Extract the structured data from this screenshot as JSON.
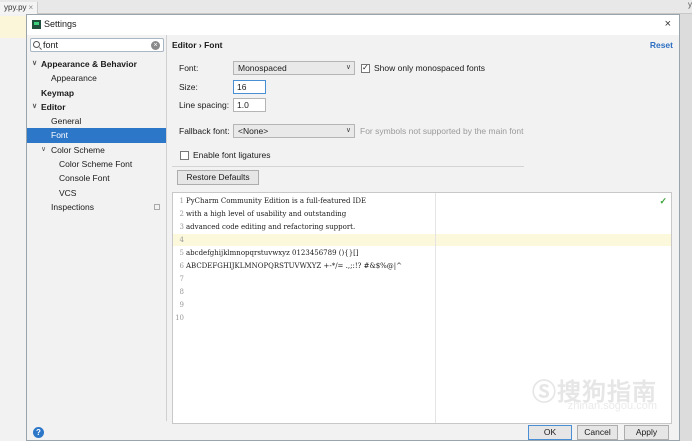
{
  "background": {
    "tab_label": "ypy.py",
    "tab_close": "×",
    "right_text": "y"
  },
  "dialog": {
    "title": "Settings",
    "close": "×"
  },
  "search": {
    "value": "font",
    "clear_glyph": "⊗"
  },
  "tree": [
    {
      "label": "Appearance & Behavior",
      "chev": "∨"
    },
    {
      "label": "Appearance"
    },
    {
      "label": "Keymap"
    },
    {
      "label": "Editor",
      "chev": "∨"
    },
    {
      "label": "General"
    },
    {
      "label": "Font"
    },
    {
      "label": "Color Scheme",
      "chev": "∨"
    },
    {
      "label": "Color Scheme Font"
    },
    {
      "label": "Console Font"
    },
    {
      "label": "VCS"
    },
    {
      "label": "Inspections"
    }
  ],
  "header": {
    "breadcrumb": "Editor › Font",
    "reset": "Reset"
  },
  "font": {
    "font_label": "Font:",
    "font_value": "Monospaced",
    "mono_only_label": "Show only monospaced fonts",
    "mono_only_checked": true,
    "size_label": "Size:",
    "size_value": "16",
    "spacing_label": "Line spacing:",
    "spacing_value": "1.0",
    "fallback_label": "Fallback font:",
    "fallback_value": "<None>",
    "fallback_hint": "For symbols not supported by the main font",
    "ligatures_label": "Enable font ligatures",
    "ligatures_checked": false,
    "restore_label": "Restore Defaults",
    "dropdown_arrow": "∨"
  },
  "preview": {
    "ok_mark": "✓",
    "lines": [
      {
        "n": "1",
        "text": "PyCharm Community Edition is a full-featured IDE"
      },
      {
        "n": "2",
        "text": "with a high level of usability and outstanding"
      },
      {
        "n": "3",
        "text": "advanced code editing and refactoring support."
      },
      {
        "n": "4",
        "text": ""
      },
      {
        "n": "5",
        "text": "abcdefghijklmnopqrstuvwxyz 0123456789 (){}[]"
      },
      {
        "n": "6",
        "text": "ABCDEFGHIJKLMNOPQRSTUVWXYZ +-*/= .,;:!? #&$%@|^"
      },
      {
        "n": "7",
        "text": ""
      },
      {
        "n": "8",
        "text": ""
      },
      {
        "n": "9",
        "text": ""
      },
      {
        "n": "10",
        "text": ""
      }
    ]
  },
  "watermark": {
    "main": "Ⓢ搜狗指南",
    "sub": "zhinan.sogou.com"
  },
  "footer": {
    "help": "?",
    "ok": "OK",
    "cancel": "Cancel",
    "apply": "Apply"
  }
}
